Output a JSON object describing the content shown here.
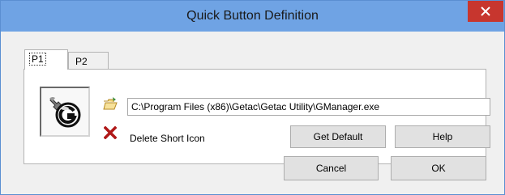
{
  "window": {
    "title": "Quick Button Definition",
    "close_glyph": "✕"
  },
  "tabs": [
    {
      "label": "P1",
      "selected": true
    },
    {
      "label": "P2",
      "selected": false
    }
  ],
  "panel": {
    "app_icon": "getac-g-manager-icon",
    "browse_icon": "folder-open-icon",
    "path_value": "C:\\Program Files (x86)\\Getac\\Getac Utility\\GManager.exe",
    "delete_icon": "red-x-delete-icon",
    "delete_label": "Delete Short Icon",
    "get_default_label": "Get Default",
    "help_label": "Help"
  },
  "footer": {
    "cancel_label": "Cancel",
    "ok_label": "OK"
  },
  "colors": {
    "titlebar": "#6fa3e4",
    "close_button": "#c7362e",
    "delete_icon": "#b01818"
  }
}
